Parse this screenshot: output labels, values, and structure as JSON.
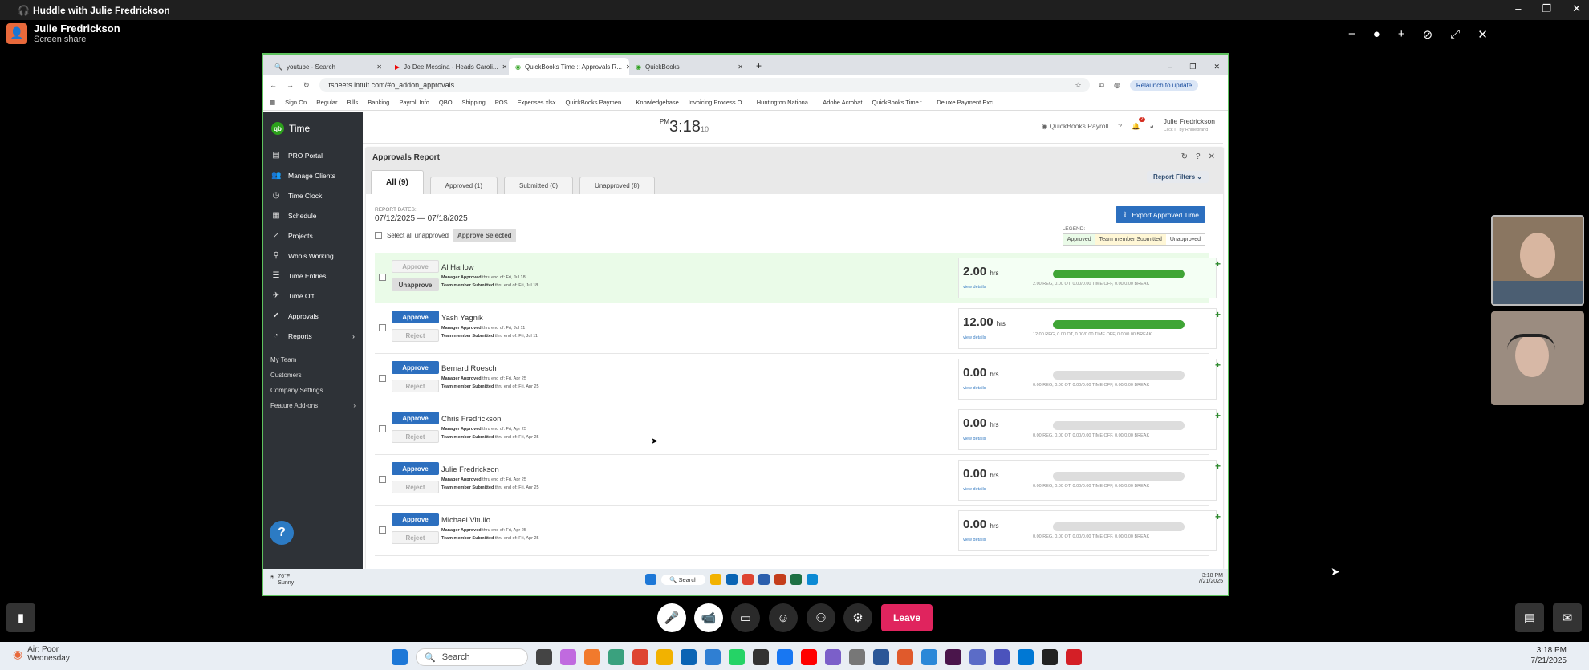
{
  "window": {
    "title": "Huddle with Julie Fredrickson",
    "controls": [
      "–",
      "❐",
      "✕"
    ]
  },
  "presenter": {
    "name": "Julie Fredrickson",
    "status": "Screen share"
  },
  "huddle_controls": [
    "−",
    "●",
    "+",
    "⊘",
    "⤢",
    "✕"
  ],
  "browser": {
    "tabs": [
      {
        "label": "youtube - Search"
      },
      {
        "label": "Jo Dee Messina - Heads Caroli..."
      },
      {
        "label": "QuickBooks Time :: Approvals R..."
      },
      {
        "label": "QuickBooks"
      }
    ],
    "url": "tsheets.intuit.com/#o_addon_approvals",
    "relaunch": "Relaunch to update",
    "bookmarks": [
      "Sign On",
      "Regular",
      "Bills",
      "Banking",
      "Payroll Info",
      "QBO",
      "Shipping",
      "POS",
      "Expenses.xlsx",
      "QuickBooks Paymen...",
      "Knowledgebase",
      "Invoicing Process O...",
      "Huntington Nationa...",
      "Adobe Acrobat",
      "QuickBooks Time :...",
      "Deluxe Payment Exc..."
    ]
  },
  "app": {
    "logo": "Time",
    "nav": [
      {
        "label": "PRO Portal",
        "icon": "▤"
      },
      {
        "label": "Manage Clients",
        "icon": "👥"
      },
      {
        "label": "Time Clock",
        "icon": "◷"
      },
      {
        "label": "Schedule",
        "icon": "▦"
      },
      {
        "label": "Projects",
        "icon": "↗"
      },
      {
        "label": "Who's Working",
        "icon": "⚲"
      },
      {
        "label": "Time Entries",
        "icon": "☰"
      },
      {
        "label": "Time Off",
        "icon": "✈"
      },
      {
        "label": "Approvals",
        "icon": "✔"
      },
      {
        "label": "Reports",
        "icon": "◔"
      }
    ],
    "sub_nav": [
      "My Team",
      "Customers",
      "Company Settings",
      "Feature Add-ons"
    ],
    "clock": {
      "ampm": "PM",
      "time": "3:18",
      "seconds": "10"
    },
    "payroll": "QuickBooks Payroll",
    "notif_count": "2",
    "user": {
      "name": "Julie Fredrickson",
      "sub": "Click IT by Rhinebrand"
    }
  },
  "report": {
    "title": "Approvals Report",
    "filters": "Report Filters",
    "tabs": [
      "All (9)",
      "Approved (1)",
      "Submitted (0)",
      "Unapproved (8)"
    ],
    "dates_label": "REPORT DATES:",
    "dates": "07/12/2025 — 07/18/2025",
    "select_all": "Select all unapproved",
    "approve_selected": "Approve Selected",
    "export": "Export Approved Time",
    "legend_label": "LEGEND:",
    "legend": [
      "Approved",
      "Team member Submitted",
      "Unapproved"
    ],
    "rows": [
      {
        "name": "Al Harlow",
        "approved": true,
        "btn1": "Approve",
        "btn2": "Unapprove",
        "mgr": "Manager Approved",
        "mgr_thru": "thru end of: Fri, Jul 18",
        "tm": "Team member Submitted",
        "tm_thru": "thru end of: Fri, Jul 18",
        "hours": "2.00",
        "progress": 1.0,
        "breakdown": "2.00 REG, 0.00 OT, 0.00/0.00 TIME OFF, 0.00/0.00 BREAK"
      },
      {
        "name": "Yash Yagnik",
        "approved": false,
        "btn1": "Approve",
        "btn2": "Reject",
        "mgr": "Manager Approved",
        "mgr_thru": "thru end of: Fri, Jul 11",
        "tm": "Team member Submitted",
        "tm_thru": "thru end of: Fri, Jul 11",
        "hours": "12.00",
        "progress": 1.0,
        "breakdown": "12.00 REG, 0.00 OT, 0.00/0.00 TIME OFF, 0.00/0.00 BREAK"
      },
      {
        "name": "Bernard Roesch",
        "approved": false,
        "btn1": "Approve",
        "btn2": "Reject",
        "mgr": "Manager Approved",
        "mgr_thru": "thru end of: Fri, Apr 25",
        "tm": "Team member Submitted",
        "tm_thru": "thru end of: Fri, Apr 25",
        "hours": "0.00",
        "progress": 0,
        "breakdown": "0.00 REG, 0.00 OT, 0.00/0.00 TIME OFF, 0.00/0.00 BREAK"
      },
      {
        "name": "Chris Fredrickson",
        "approved": false,
        "btn1": "Approve",
        "btn2": "Reject",
        "mgr": "Manager Approved",
        "mgr_thru": "thru end of: Fri, Apr 25",
        "tm": "Team member Submitted",
        "tm_thru": "thru end of: Fri, Apr 25",
        "hours": "0.00",
        "progress": 0,
        "breakdown": "0.00 REG, 0.00 OT, 0.00/0.00 TIME OFF, 0.00/0.00 BREAK"
      },
      {
        "name": "Julie Fredrickson",
        "approved": false,
        "btn1": "Approve",
        "btn2": "Reject",
        "mgr": "Manager Approved",
        "mgr_thru": "thru end of: Fri, Apr 25",
        "tm": "Team member Submitted",
        "tm_thru": "thru end of: Fri, Apr 25",
        "hours": "0.00",
        "progress": 0,
        "breakdown": "0.00 REG, 0.00 OT, 0.00/0.00 TIME OFF, 0.00/0.00 BREAK"
      },
      {
        "name": "Michael Vitullo",
        "approved": false,
        "btn1": "Approve",
        "btn2": "Reject",
        "mgr": "Manager Approved",
        "mgr_thru": "thru end of: Fri, Apr 25",
        "tm": "Team member Submitted",
        "tm_thru": "thru end of: Fri, Apr 25",
        "hours": "0.00",
        "progress": 0,
        "breakdown": "0.00 REG, 0.00 OT, 0.00/0.00 TIME OFF, 0.00/0.00 BREAK"
      }
    ],
    "hrs_unit": "hrs",
    "view_details": "view details"
  },
  "remote_taskbar": {
    "temp": "76°F",
    "cond": "Sunny",
    "search": "Search",
    "time": "3:18 PM",
    "date": "7/21/2025"
  },
  "call": {
    "leave": "Leave"
  },
  "taskbar": {
    "weather_title": "Air: Poor",
    "weather_day": "Wednesday",
    "search": "Search",
    "time": "3:18 PM",
    "date": "7/21/2025"
  },
  "colors": {
    "accent": "#2c6fbf",
    "approved_bg": "#eafbe8",
    "leave": "#e0245e",
    "qb_green": "#2ca01c"
  }
}
